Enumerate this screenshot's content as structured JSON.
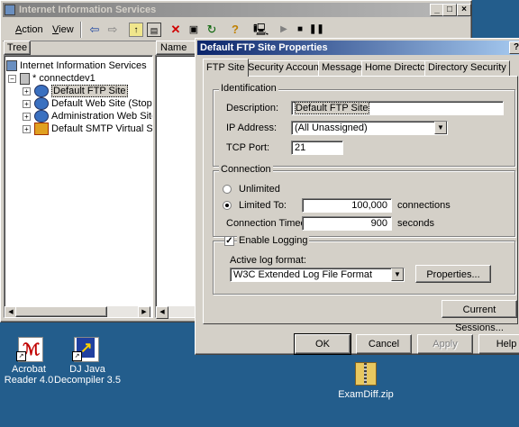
{
  "iis_window": {
    "title": "Internet Information Services",
    "menu": [
      {
        "label": "Action",
        "ul": "A"
      },
      {
        "label": "View",
        "ul": "V"
      }
    ],
    "tree_header": "Tree",
    "name_header": "Name",
    "tree": {
      "root": "Internet Information Services",
      "server": "* connectdev1",
      "items": [
        "Default FTP Site",
        "Default Web Site (Stopped)",
        "Administration Web Site (Sto",
        "Default SMTP Virtual Server ("
      ]
    }
  },
  "dialog": {
    "title": "Default FTP Site Properties",
    "help": "?",
    "tabs": [
      "FTP Site",
      "Security Accounts",
      "Messages",
      "Home Directory",
      "Directory Security"
    ],
    "identification": {
      "label": "Identification",
      "description_label": "Description:",
      "description_value": "Default FTP Site",
      "ip_label": "IP Address:",
      "ip_value": "(All Unassigned)",
      "port_label": "TCP Port:",
      "port_value": "21"
    },
    "connection": {
      "label": "Connection",
      "unlimited_label": "Unlimited",
      "limited_label": "Limited To:",
      "limited_value": "100,000",
      "limited_unit": "connections",
      "timeout_label": "Connection Timeout:",
      "timeout_value": "900",
      "timeout_unit": "seconds",
      "selected": "limited"
    },
    "logging": {
      "enable_label": "Enable Logging",
      "enabled": true,
      "format_label": "Active log format:",
      "format_value": "W3C Extended Log File Format",
      "properties_button": "Properties..."
    },
    "current_sessions_button": "Current Sessions...",
    "buttons": {
      "ok": "OK",
      "cancel": "Cancel",
      "apply": "Apply",
      "help": "Help"
    }
  },
  "desktop": {
    "icons": [
      {
        "name": "Acrobat Reader 4.0",
        "line1": "Acrobat",
        "line2": "Reader 4.0"
      },
      {
        "name": "DJ Java Decompiler 3.5",
        "line1": "DJ Java",
        "line2": "Decompiler 3.5"
      },
      {
        "name": "ExamDiff.zip",
        "line1": "ExamDiff.zip"
      }
    ]
  },
  "colors": {
    "desktop": "#235d8c",
    "active_title": "#0a246a",
    "inactive_title": "#808080",
    "face": "#d4d0c8"
  }
}
